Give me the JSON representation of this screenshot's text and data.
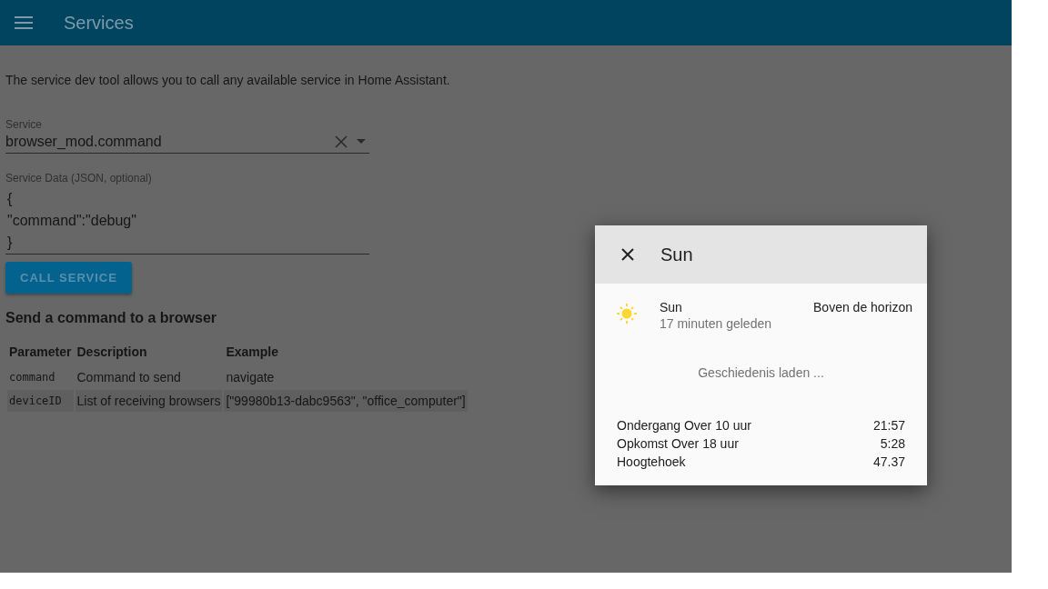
{
  "toolbar": {
    "title": "Services"
  },
  "intro": "The service dev tool allows you to call any available service in Home Assistant.",
  "service_field": {
    "label": "Service",
    "value": "browser_mod.command"
  },
  "data_field": {
    "label": "Service Data (JSON, optional)",
    "lines": [
      "{",
      "\"command\":\"debug\"",
      "}"
    ]
  },
  "call_button": "CALL SERVICE",
  "section_title": "Send a command to a browser",
  "table": {
    "columns": [
      "Parameter",
      "Description",
      "Example"
    ],
    "rows": [
      [
        "command",
        "Command to send",
        "navigate"
      ],
      [
        "deviceID",
        "List of receiving browsers",
        "[\"99980b13-dabc9563\", \"office_computer\"]"
      ]
    ]
  },
  "dialog": {
    "title": "Sun",
    "entity_name": "Sun",
    "last_changed": "17 minuten geleden",
    "state": "Boven de horizon",
    "history": "Geschiedenis laden ...",
    "attributes": [
      {
        "label": "Ondergang Over 10 uur",
        "value": "21:57"
      },
      {
        "label": "Opkomst Over 18 uur",
        "value": "5:28"
      },
      {
        "label": "Hoogtehoek",
        "value": "47.37"
      }
    ]
  }
}
